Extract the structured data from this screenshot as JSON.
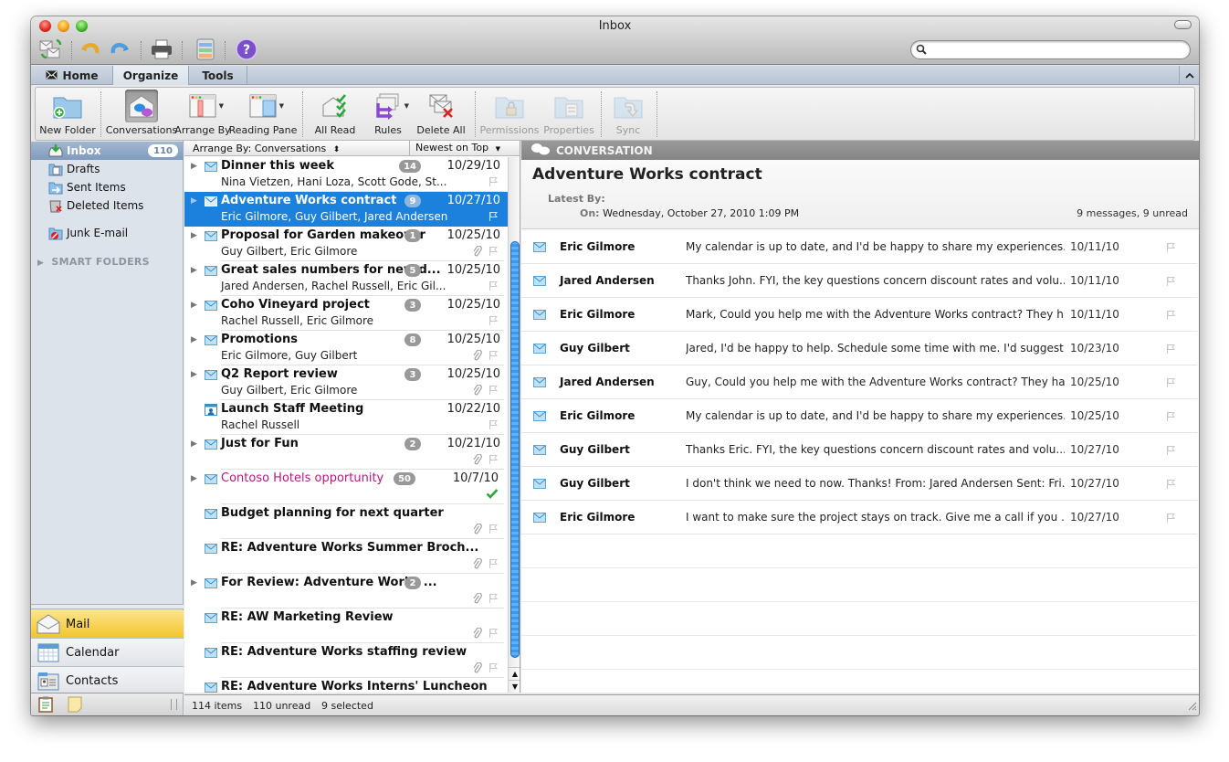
{
  "window": {
    "title": "Inbox"
  },
  "toolbar": {
    "icons": [
      "send-receive-icon",
      "undo-icon",
      "redo-icon",
      "print-icon",
      "reminders-icon",
      "help-icon"
    ],
    "search": {
      "value": "",
      "placeholder": ""
    }
  },
  "tabs": [
    {
      "label": "Home",
      "active": false
    },
    {
      "label": "Organize",
      "active": true
    },
    {
      "label": "Tools",
      "active": false
    }
  ],
  "ribbon": {
    "new_folder": "New Folder",
    "conversations": "Conversations",
    "arrange_by": "Arrange By",
    "reading_pane": "Reading Pane",
    "all_read": "All Read",
    "rules": "Rules",
    "delete_all": "Delete All",
    "permissions": "Permissions",
    "properties": "Properties",
    "sync": "Sync"
  },
  "sidebar": {
    "folders": [
      {
        "label": "Inbox",
        "count": "110",
        "selected": true
      },
      {
        "label": "Drafts"
      },
      {
        "label": "Sent Items"
      },
      {
        "label": "Deleted Items"
      },
      {
        "label": "Junk E-mail"
      }
    ],
    "smart_folders": "SMART FOLDERS",
    "nav": [
      {
        "label": "Mail",
        "active": true
      },
      {
        "label": "Calendar"
      },
      {
        "label": "Contacts"
      }
    ]
  },
  "list": {
    "arrange_label": "Arrange By: Conversations",
    "sort_label": "Newest on Top",
    "items": [
      {
        "subject": "Dinner this week",
        "from": "Nina Vietzen, Hani Loza, Scott Gode, St...",
        "count": "14",
        "date": "10/29/10",
        "thread": true,
        "clip": false
      },
      {
        "subject": "Adventure Works contract",
        "from": "Eric Gilmore, Guy Gilbert, Jared Andersen",
        "count": "9",
        "date": "10/27/10",
        "thread": true,
        "selected": true,
        "clip": false
      },
      {
        "subject": "Proposal for Garden makeover",
        "from": "Guy Gilbert, Eric Gilmore",
        "count": "1",
        "date": "10/25/10",
        "thread": true,
        "clip": true
      },
      {
        "subject": "Great sales numbers for new d...",
        "from": "Jared Andersen, Rachel Russell, Eric Gil...",
        "count": "5",
        "date": "10/25/10",
        "thread": true,
        "clip": false
      },
      {
        "subject": "Coho Vineyard project",
        "from": "Rachel Russell, Eric Gilmore",
        "count": "3",
        "date": "10/25/10",
        "thread": true,
        "clip": false
      },
      {
        "subject": "Promotions",
        "from": "Eric Gilmore, Guy Gilbert",
        "count": "8",
        "date": "10/25/10",
        "thread": true,
        "clip": true
      },
      {
        "subject": "Q2 Report review",
        "from": "Guy Gilbert, Eric Gilmore",
        "count": "3",
        "date": "10/25/10",
        "thread": true,
        "clip": true
      },
      {
        "subject": "Launch Staff Meeting",
        "from": "Rachel Russell",
        "count": "",
        "date": "10/22/10",
        "thread": false,
        "meeting": true,
        "clip": false
      },
      {
        "subject": "Just for Fun",
        "from": "",
        "count": "2",
        "date": "10/21/10",
        "thread": true,
        "clip": true
      },
      {
        "subject": "Contoso Hotels opportunity",
        "from": "",
        "count": "50",
        "date": "10/7/10",
        "thread": true,
        "pink": true,
        "completed": true
      },
      {
        "subject": "Budget planning for next quarter",
        "from": "",
        "count": "",
        "date": "",
        "thread": false,
        "clip": true
      },
      {
        "subject": "RE: Adventure Works Summer Broch...",
        "from": "",
        "count": "",
        "date": "",
        "thread": false,
        "clip": true
      },
      {
        "subject": "For Review: Adventure Works ...",
        "from": "",
        "count": "2",
        "date": "",
        "thread": true,
        "clip": true
      },
      {
        "subject": "RE: AW Marketing Review",
        "from": "",
        "count": "",
        "date": "",
        "thread": false,
        "clip": true
      },
      {
        "subject": "RE: Adventure Works staffing review",
        "from": "",
        "count": "",
        "date": "",
        "thread": false,
        "clip": true
      },
      {
        "subject": "RE: Adventure Works Interns' Luncheon",
        "from": "",
        "count": "",
        "date": "",
        "thread": false,
        "clip": false
      }
    ]
  },
  "status": {
    "items": "114 items",
    "unread": "110 unread",
    "selected": "9 selected"
  },
  "reading": {
    "bar_label": "CONVERSATION",
    "title": "Adventure Works contract",
    "latest_by_label": "Latest By:",
    "on_label": "On:",
    "on_value": "Wednesday, October 27, 2010 1:09 PM",
    "count_summary": "9 messages, 9 unread",
    "messages": [
      {
        "sender": "Eric Gilmore",
        "preview": "My calendar is up to date, and I'd be happy to share my experiences....",
        "date": "10/11/10"
      },
      {
        "sender": "Jared Andersen",
        "preview": "Thanks John. FYI, the key questions concern discount rates and volu...",
        "date": "10/11/10"
      },
      {
        "sender": "Eric Gilmore",
        "preview": "Mark, Could you help me with the Adventure Works contract? They h...",
        "date": "10/11/10"
      },
      {
        "sender": "Guy Gilbert",
        "preview": "Jared, I'd be happy to help. Schedule some time with me. I'd suggest...",
        "date": "10/23/10"
      },
      {
        "sender": "Jared Andersen",
        "preview": "Guy, Could you help me with the Adventure Works contract? They ha...",
        "date": "10/25/10"
      },
      {
        "sender": "Eric Gilmore",
        "preview": "My calendar is up to date, and I'd be happy to share my experiences....",
        "date": "10/25/10"
      },
      {
        "sender": "Guy Gilbert",
        "preview": "Thanks Eric. FYI, the key questions concern discount rates and volu...",
        "date": "10/27/10"
      },
      {
        "sender": "Guy Gilbert",
        "preview": "I don't think we need to now. Thanks! From: Jared Andersen Sent: Fri...",
        "date": "10/27/10"
      },
      {
        "sender": "Eric Gilmore",
        "preview": "I want to make sure the project stays on track. Give me a call if you ...",
        "date": "10/27/10"
      }
    ]
  },
  "colors": {
    "selection": "#1c80dd",
    "category_pink": "#b4197e",
    "nav_active": "#f3c62d"
  }
}
